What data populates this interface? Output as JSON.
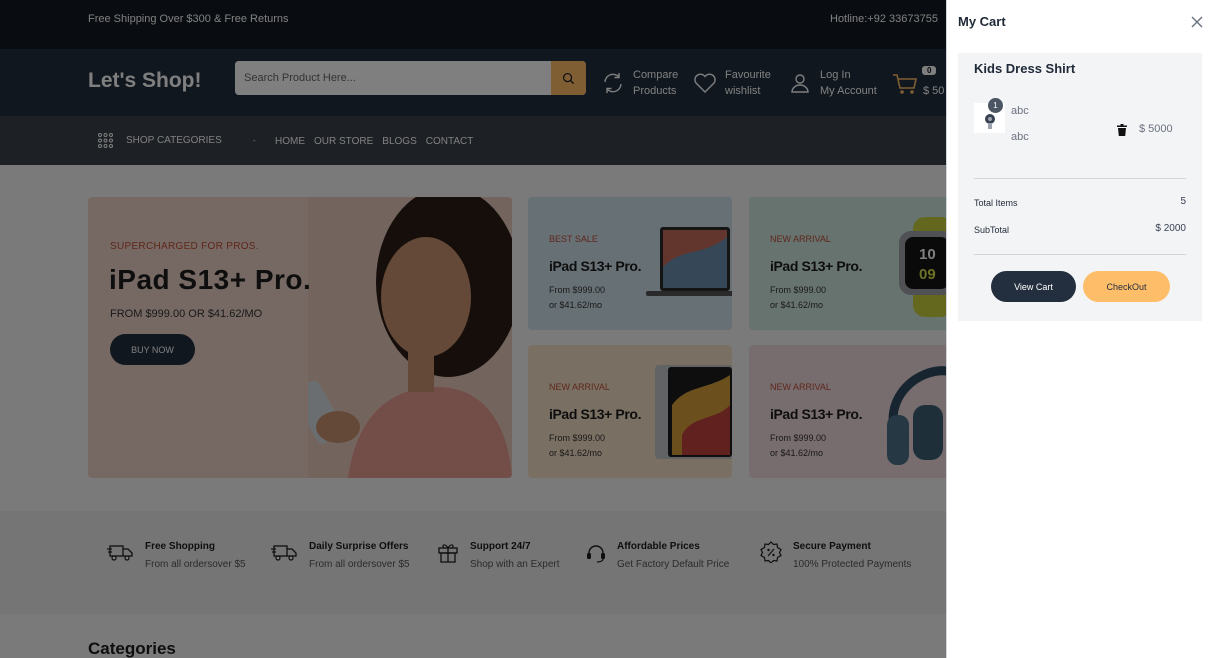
{
  "topbar": {
    "shipping_text": "Free Shipping Over $300 & Free Returns",
    "hotline_text": "Hotline:+92 33673755"
  },
  "header": {
    "logo": "Let's Shop!",
    "search_placeholder": "Search Product Here...",
    "compare": [
      "Compare",
      "Products"
    ],
    "wishlist": [
      "Favourite",
      "wishlist"
    ],
    "account": [
      "Log In",
      "My Account"
    ],
    "cart_badge": "0",
    "cart_amount": "$ 50"
  },
  "nav": {
    "shop_categories": "SHOP CATEGORIES",
    "caret": "-",
    "links": [
      "HOME",
      "OUR STORE",
      "BLOGS",
      "CONTACT"
    ]
  },
  "hero": {
    "supertitle": "SUPERCHARGED FOR PROS.",
    "title": "iPad S13+ Pro.",
    "price": "FROM $999.00 OR $41.62/MO",
    "button": "BUY NOW"
  },
  "cards": [
    {
      "label": "BEST SALE",
      "title": "iPad S13+ Pro.",
      "price1": "From $999.00",
      "price2": "or $41.62/mo"
    },
    {
      "label": "NEW ARRIVAL",
      "title": "iPad S13+ Pro.",
      "price1": "From $999.00",
      "price2": "or $41.62/mo"
    },
    {
      "label": "NEW ARRIVAL",
      "title": "iPad S13+ Pro.",
      "price1": "From $999.00",
      "price2": "or $41.62/mo"
    },
    {
      "label": "NEW ARRIVAL",
      "title": "iPad S13+ Pro.",
      "price1": "From $999.00",
      "price2": "or $41.62/mo"
    }
  ],
  "watch_face": [
    "10",
    "09"
  ],
  "services": [
    {
      "title": "Free Shopping",
      "sub": "From all ordersover $5",
      "icon": "truck-icon"
    },
    {
      "title": "Daily Surprise Offers",
      "sub": "From all ordersover $5",
      "icon": "truck-icon"
    },
    {
      "title": "Support 24/7",
      "sub": "Shop with an Expert",
      "icon": "gift-icon"
    },
    {
      "title": "Affordable Prices",
      "sub": "Get Factory Default Price",
      "icon": "headset-icon"
    },
    {
      "title": "Secure Payment",
      "sub": "100% Protected Payments",
      "icon": "discount-badge-icon"
    }
  ],
  "categories_heading": "Categories",
  "cart": {
    "title": "My Cart",
    "item": {
      "name": "Kids Dress Shirt",
      "quantity": "1",
      "attr1": "abc",
      "attr2": "abc",
      "price": "$ 5000"
    },
    "total_items_label": "Total Items",
    "total_items_value": "5",
    "subtotal_label": "SubTotal",
    "subtotal_value": "$ 2000",
    "view_cart": "View Cart",
    "checkout": "CheckOut"
  },
  "colors": {
    "dark_navy": "#131921",
    "header_navy": "#232f3e",
    "accent_orange": "#febd69"
  }
}
